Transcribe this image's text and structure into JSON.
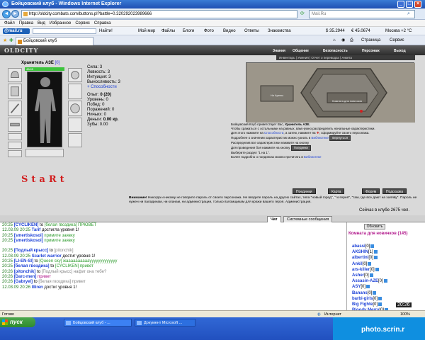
{
  "window": {
    "title": "Бойцовский клуб - Windows Internet Explorer"
  },
  "address": {
    "url": "http://oldcity.combats.com/buttons.pl?battle=0.320292023989666",
    "search_placeholder": "Mail.Ru"
  },
  "menu": [
    "Файл",
    "Правка",
    "Вид",
    "Избранное",
    "Сервис",
    "Справка"
  ],
  "mailbar": {
    "logo": "@mail.ru",
    "find": "Найти!",
    "items": [
      "Мой мир",
      "Файлы",
      "Блоги",
      "Фото",
      "Видео",
      "Ответы",
      "Знакомства"
    ],
    "rates": {
      "usd": "$ 35.2944",
      "eur": "€ 45.0674",
      "city": "Москва +2 °С"
    }
  },
  "tab": {
    "title": "Бойцовский клуб",
    "tools": [
      "Страница",
      "Сервис"
    ]
  },
  "game": {
    "logo": "OLDCITY",
    "nav": [
      "Знания",
      "Общение",
      "Безопасность",
      "Персонаж",
      "Выход"
    ],
    "subnav": "Инвентарь | Умения | Отчет о переводах | Анкета",
    "character": {
      "name": "Хранитель АЗЕ",
      "level": "[0]",
      "hp": "45/45"
    },
    "stats": [
      {
        "label": "Сила:",
        "value": "3"
      },
      {
        "label": "Ловкость:",
        "value": "3"
      },
      {
        "label": "Интуиция:",
        "value": "3"
      },
      {
        "label": "Выносливость:",
        "value": "3"
      }
    ],
    "abilities_link": "+ Способности",
    "stats2": [
      {
        "label": "Опыт:",
        "value": "0 (20)"
      },
      {
        "label": "Уровень:",
        "value": "0"
      },
      {
        "label": "Побед:",
        "value": "0"
      },
      {
        "label": "Поражений:",
        "value": "0"
      },
      {
        "label": "Ничьих:",
        "value": "0"
      },
      {
        "label": "Деньги:",
        "value": "0.00 кр."
      },
      {
        "label": "Зубы:",
        "value": "0.00"
      }
    ],
    "start_text": "StaRt",
    "map": {
      "left_sign": "На Арены",
      "right_sign": "Комната для новичков"
    },
    "welcome": {
      "line1a": "Бойцовский Клуб приветствует Вас, ",
      "line1b": "Хранитель АЗЕ.",
      "line2": "Чтобы сражаться с остальными на равных, вам нужно распределить начальные характеристики.",
      "line3a": "Для этого нажмите на ",
      "line3b": "Способности",
      "line3c": ", а затем, нажмите на",
      "line3d": ", сформируйте своего персонажа.",
      "line4a": "Подробнее о значении характеристик можно узнать в ",
      "line4b": "Библиотеке",
      "return_btn": "Вернуться",
      "line5": "Распределив все характеристики нажмите на кнопку",
      "line6": "Для проведения боя нажмите на кнопку",
      "fights_btn": "Поединки",
      "line7": "Выберите раздел \"1 на 1\".",
      "line8a": "Более подробно о поединках можно прочитать в ",
      "line8b": "Библиотеке"
    },
    "buttons": [
      "Поединки",
      "Карта клуба",
      "Форум",
      "Подсказка"
    ],
    "attention_bold": "Внимание!",
    "attention": "Никогда и никому не говорите пароль от своего персонажа. Не вводите пароль на других сайтах, типа \"новый город\", \"лотерея\", \"там, где все дают на халяву\". Пароль не нужен ни паладинам, ни кланам, ни администрации, только взломщикам для кражи вашего героя.",
    "admin": "Администрация.",
    "online": "Сейчас в клубе 2675 чел."
  },
  "chat": {
    "tabs": [
      "Чат",
      "Системные сообщения"
    ],
    "lines": [
      {
        "time": "20:25",
        "nick": "[CYCLIKEN]",
        "mid": " to ",
        "to": "[белая гвоздика]",
        "text": " ПРЮВЕТ",
        "tone": "g"
      },
      {
        "time": "12.03.09 20:25",
        "nick": "Tarif",
        "mid": " достигла уровня 1!",
        "to": "",
        "text": "",
        "tone": "g"
      },
      {
        "time": "20:25",
        "nick": "[smertiskosoi]",
        "mid": " ",
        "to": "",
        "text": "примите заявку",
        "tone": "g"
      },
      {
        "time": "20:25",
        "nick": "[smertiskosoi]",
        "mid": " ",
        "to": "",
        "text": "примите заявку",
        "tone": "g"
      },
      {
        "time": "",
        "nick": "",
        "mid": "",
        "to": "",
        "text": "",
        "tone": "g"
      },
      {
        "time": "20:25",
        "nick": "[Подлый крысс]",
        "mid": " to ",
        "to": "[pitonchik]",
        "text": "",
        "tone": "gr"
      },
      {
        "time": "12.03.09 20:25",
        "nick": "Scarlet warrior",
        "mid": " достиг уровня 1!",
        "to": "",
        "text": "",
        "tone": "g"
      },
      {
        "time": "20:25",
        "nick": "[LI-EN-SI]",
        "mid": " to ",
        "to": "[Queen sky]",
        "text": " жааааааааааууууууууууууу",
        "tone": "g"
      },
      {
        "time": "20:25",
        "nick": "[белая гвоздика]",
        "mid": " to ",
        "to": "[CYCLIKEN]",
        "text": " привет",
        "tone": "g"
      },
      {
        "time": "20:26",
        "nick": "[pitonchik]",
        "mid": " to ",
        "to": "[Подлый крысс]",
        "text": " нафиг она тебе?",
        "tone": "gr"
      },
      {
        "time": "20:26",
        "nick": "[Darc-men]",
        "mid": " ",
        "to": "",
        "text": "привет",
        "tone": "m"
      },
      {
        "time": "20:26",
        "nick": "[Gabryel]",
        "mid": " to ",
        "to": "[белая гвоздика]",
        "text": " привет",
        "tone": "gr"
      },
      {
        "time": "12.03.09 20:26",
        "nick": "Illiren",
        "mid": " достиг уровня 1!",
        "to": "",
        "text": "",
        "tone": "g"
      }
    ],
    "refresh": "Обновить",
    "room_title": "Комната для новичков (145)",
    "users": [
      {
        "name": "abassi",
        "lvl": "[0]"
      },
      {
        "name": "AKSHIN",
        "lvl": "[1]"
      },
      {
        "name": "albertini",
        "lvl": "[0]"
      },
      {
        "name": "Ankil",
        "lvl": "[0]"
      },
      {
        "name": "ars-killer",
        "lvl": "[0]"
      },
      {
        "name": "Asher",
        "lvl": "[0]"
      },
      {
        "name": "Assasin-AZE",
        "lvl": "[0]"
      },
      {
        "name": "ASY",
        "lvl": "[0]"
      },
      {
        "name": "Banans",
        "lvl": "[0]"
      },
      {
        "name": "barbi-girls",
        "lvl": "[0]"
      },
      {
        "name": "Big Fighte",
        "lvl": "[0]"
      },
      {
        "name": "Bloody Merry",
        "lvl": "[0]"
      }
    ],
    "clock": "20:26"
  },
  "status": {
    "left": "Готово",
    "zone": "Интернет",
    "zoom": "100%"
  },
  "taskbar": {
    "start": "пуск",
    "items": [
      "Бойцовский клуб - ...",
      "Документ Microsoft ..."
    ],
    "watermark": "photo.scrin.r"
  }
}
